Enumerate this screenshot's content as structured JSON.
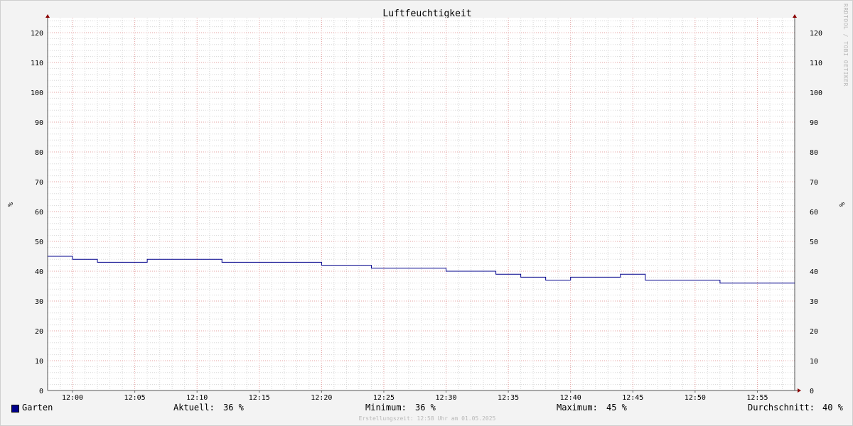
{
  "chart_data": {
    "type": "line",
    "title": "Luftfeuchtigkeit",
    "ylabel": "%",
    "ylim": [
      0,
      125
    ],
    "yticks": [
      0,
      10,
      20,
      30,
      40,
      50,
      60,
      70,
      80,
      90,
      100,
      110,
      120
    ],
    "xrange_minutes": [
      -2,
      58
    ],
    "xticks": [
      "12:00",
      "12:05",
      "12:10",
      "12:15",
      "12:20",
      "12:25",
      "12:30",
      "12:35",
      "12:40",
      "12:45",
      "12:50",
      "12:55"
    ],
    "grid": true,
    "series": [
      {
        "name": "Garten",
        "color": "#00008b",
        "step": true,
        "x": [
          "11:58",
          "12:00",
          "12:02",
          "12:06",
          "12:12",
          "12:20",
          "12:24",
          "12:30",
          "12:34",
          "12:36",
          "12:38",
          "12:40",
          "12:44",
          "12:46",
          "12:52",
          "12:58"
        ],
        "values": [
          45,
          44,
          43,
          44,
          43,
          42,
          41,
          40,
          39,
          38,
          37,
          38,
          39,
          37,
          36,
          36
        ]
      }
    ]
  },
  "legend": {
    "series_name": "Garten",
    "current_label": "Aktuell:",
    "current_value": "36 %",
    "min_label": "Minimum:",
    "min_value": "36 %",
    "max_label": "Maximum:",
    "max_value": "45 %",
    "avg_label": "Durchschnitt:",
    "avg_value": "40 %"
  },
  "footer": "Erstellungszeit: 12:58 Uhr am 01.05.2025",
  "watermark": "RRDTOOL / TOBI OETIKER"
}
